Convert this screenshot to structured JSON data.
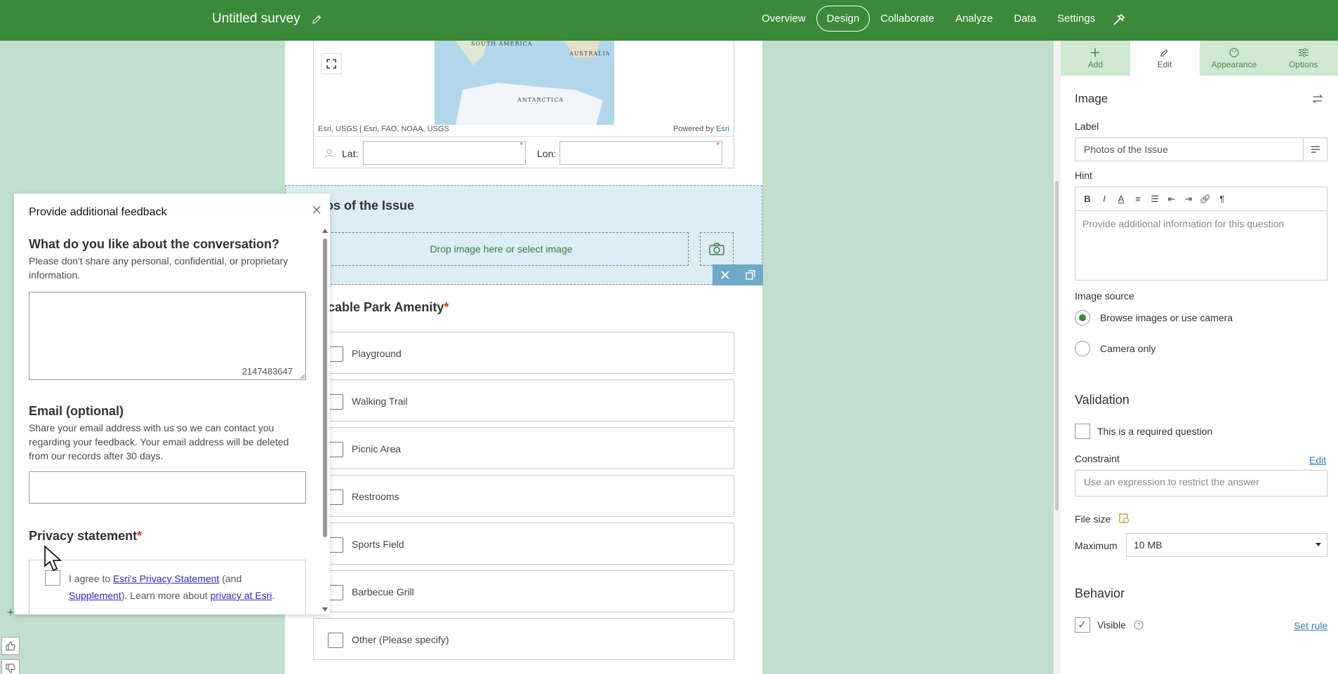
{
  "header": {
    "survey_title": "Untitled survey",
    "nav": [
      "Overview",
      "Design",
      "Collaborate",
      "Analyze",
      "Data",
      "Settings"
    ],
    "active_nav": "Design",
    "bg_color": "#3a8a3a"
  },
  "map": {
    "labels": {
      "south_america": "SOUTH AMERICA",
      "australia": "AUSTRALIA",
      "antarctica": "ANTARCTICA"
    },
    "attribution": "Esri, USGS | Esri, FAO, NOAA, USGS",
    "powered_by": "Powered by",
    "powered_link": "Esri",
    "lat_label": "Lat:",
    "lon_label": "Lon:",
    "degree_symbol": "°"
  },
  "image_question": {
    "title": "otos of the Issue",
    "dropzone_text": "Drop image here or select image"
  },
  "amenity_question": {
    "title": "plicable Park Amenity",
    "required_mark": "*",
    "choices": [
      "Playground",
      "Walking Trail",
      "Picnic Area",
      "Restrooms",
      "Sports Field",
      "Barbecue Grill",
      "Other (Please specify)"
    ]
  },
  "panel": {
    "tabs": [
      "Add",
      "Edit",
      "Appearance",
      "Options"
    ],
    "active_tab": "Edit",
    "section_title": "Image",
    "label_label": "Label",
    "label_value": "Photos of the Issue",
    "hint_label": "Hint",
    "hint_placeholder": "Provide additional information for this question",
    "image_source_label": "Image source",
    "image_source_options": [
      "Browse images or use camera",
      "Camera only"
    ],
    "image_source_selected": "Browse images or use camera",
    "validation_title": "Validation",
    "required_label": "This is a required question",
    "required_checked": false,
    "constraint_label": "Constraint",
    "constraint_edit": "Edit",
    "constraint_placeholder": "Use an expression to restrict the answer",
    "filesize_label": "File size",
    "maximum_label": "Maximum",
    "maximum_value": "10 MB",
    "behavior_title": "Behavior",
    "visible_label": "Visible",
    "visible_checked": true,
    "set_rule": "Set rule"
  },
  "feedback": {
    "title": "Provide additional feedback",
    "q1_title": "What do you like about the conversation?",
    "q1_desc": "Please don't share any personal, confidential, or proprietary information.",
    "char_count": "2147483647",
    "email_title": "Email (optional)",
    "email_desc": "Share your email address with us so we can contact you regarding your feedback. Your email address will be deleted from our records after 30 days.",
    "privacy_title": "Privacy statement",
    "privacy_required": "*",
    "agree_prefix": "I agree to ",
    "agree_link1": "Esri's Privacy Statement",
    "agree_mid": " (and ",
    "agree_link2": "Supplement",
    "agree_mid2": "). Learn more about ",
    "agree_link3": "privacy at Esri",
    "agree_suffix": "."
  }
}
